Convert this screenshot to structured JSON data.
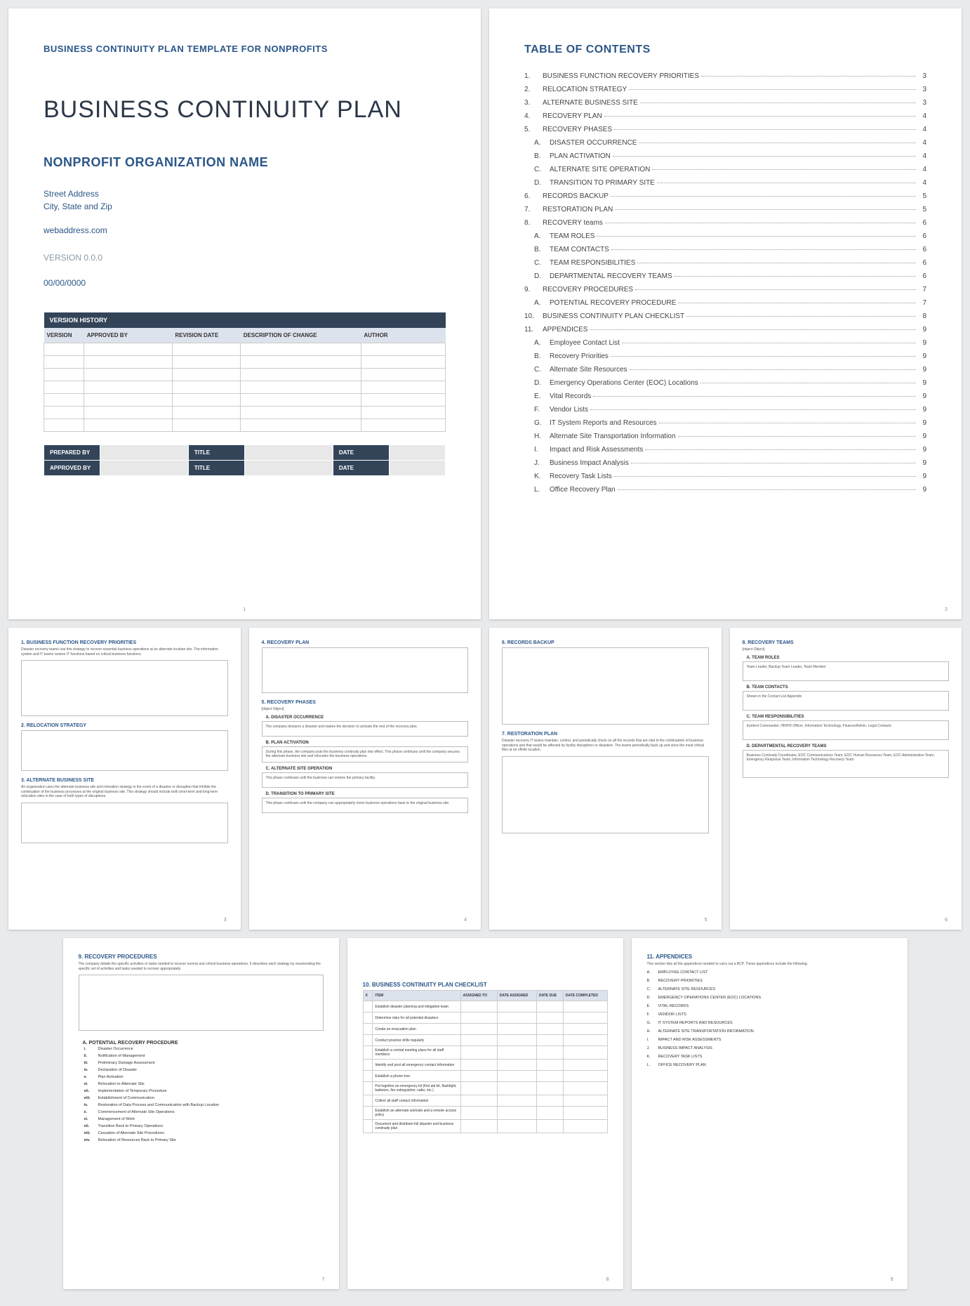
{
  "p1": {
    "header": "BUSINESS CONTINUITY PLAN TEMPLATE FOR NONPROFITS",
    "title": "BUSINESS CONTINUITY PLAN",
    "org": "NONPROFIT ORGANIZATION NAME",
    "addr1": "Street Address",
    "addr2": "City, State and Zip",
    "web": "webaddress.com",
    "ver": "VERSION 0.0.0",
    "date": "00/00/0000",
    "vh": {
      "title": "VERSION HISTORY",
      "cols": [
        "VERSION",
        "APPROVED BY",
        "REVISION DATE",
        "DESCRIPTION OF CHANGE",
        "AUTHOR"
      ]
    },
    "sig": {
      "r1": {
        "a": "PREPARED BY",
        "b": "TITLE",
        "c": "DATE"
      },
      "r2": {
        "a": "APPROVED BY",
        "b": "TITLE",
        "c": "DATE"
      }
    },
    "pn": "1"
  },
  "p2": {
    "title": "TABLE OF CONTENTS",
    "pn": "2",
    "items": [
      {
        "n": "1.",
        "t": "BUSINESS FUNCTION RECOVERY PRIORITIES",
        "p": "3"
      },
      {
        "n": "2.",
        "t": "RELOCATION STRATEGY",
        "p": "3"
      },
      {
        "n": "3.",
        "t": "ALTERNATE BUSINESS SITE",
        "p": "3"
      },
      {
        "n": "4.",
        "t": "RECOVERY PLAN",
        "p": "4"
      },
      {
        "n": "5.",
        "t": "RECOVERY PHASES",
        "p": "4"
      },
      {
        "n": "A.",
        "t": "DISASTER OCCURRENCE",
        "p": "4",
        "s": 1
      },
      {
        "n": "B.",
        "t": "PLAN ACTIVATION",
        "p": "4",
        "s": 1
      },
      {
        "n": "C.",
        "t": "ALTERNATE SITE OPERATION",
        "p": "4",
        "s": 1
      },
      {
        "n": "D.",
        "t": "TRANSITION TO PRIMARY SITE",
        "p": "4",
        "s": 1
      },
      {
        "n": "6.",
        "t": "RECORDS BACKUP",
        "p": "5"
      },
      {
        "n": "7.",
        "t": "RESTORATION PLAN",
        "p": "5"
      },
      {
        "n": "8.",
        "t": "RECOVERY teams",
        "p": "6"
      },
      {
        "n": "A.",
        "t": "TEAM ROLES",
        "p": "6",
        "s": 1
      },
      {
        "n": "B.",
        "t": "TEAM CONTACTS",
        "p": "6",
        "s": 1
      },
      {
        "n": "C.",
        "t": "TEAM RESPONSIBILITIES",
        "p": "6",
        "s": 1
      },
      {
        "n": "D.",
        "t": "DEPARTMENTAL RECOVERY TEAMS",
        "p": "6",
        "s": 1
      },
      {
        "n": "9.",
        "t": "RECOVERY PROCEDURES",
        "p": "7"
      },
      {
        "n": "A.",
        "t": "POTENTIAL RECOVERY PROCEDURE",
        "p": "7",
        "s": 1
      },
      {
        "n": "10.",
        "t": "BUSINESS CONTINUITY PLAN CHECKLIST",
        "p": "8"
      },
      {
        "n": "11.",
        "t": "APPENDICES",
        "p": "9"
      },
      {
        "n": "A.",
        "t": "Employee Contact List",
        "p": "9",
        "s": 1
      },
      {
        "n": "B.",
        "t": "Recovery Priorities",
        "p": "9",
        "s": 1
      },
      {
        "n": "C.",
        "t": "Alternate Site Resources",
        "p": "9",
        "s": 1
      },
      {
        "n": "D.",
        "t": "Emergency Operations Center (EOC) Locations",
        "p": "9",
        "s": 1
      },
      {
        "n": "E.",
        "t": "Vital Records",
        "p": "9",
        "s": 1
      },
      {
        "n": "F.",
        "t": "Vendor Lists",
        "p": "9",
        "s": 1
      },
      {
        "n": "G.",
        "t": "IT System Reports and Resources",
        "p": "9",
        "s": 1
      },
      {
        "n": "H.",
        "t": "Alternate Site Transportation Information",
        "p": "9",
        "s": 1
      },
      {
        "n": "I.",
        "t": "Impact and Risk Assessments",
        "p": "9",
        "s": 1
      },
      {
        "n": "J.",
        "t": "Business Impact Analysis",
        "p": "9",
        "s": 1
      },
      {
        "n": "K.",
        "t": "Recovery Task Lists",
        "p": "9",
        "s": 1
      },
      {
        "n": "L.",
        "t": "Office Recovery Plan",
        "p": "9",
        "s": 1
      }
    ]
  },
  "p3": {
    "pn": "3",
    "s1": {
      "h": "1. BUSINESS FUNCTION RECOVERY PRIORITIES",
      "d": "Disaster recovery teams use this strategy to recover essential business operations at an alternate location site. The information system and IT teams restore IT functions based on critical business functions."
    },
    "s2": {
      "h": "2. RELOCATION STRATEGY",
      "d": ""
    },
    "s3": {
      "h": "3. ALTERNATE BUSINESS SITE",
      "d": "An organization uses the alternate business site and relocation strategy in the event of a disaster or disruption that inhibits the continuation of the business processes at the original business site. This strategy should include both short-term and long-term relocation sites in the case of both types of disruptions."
    }
  },
  "p4": {
    "pn": "4",
    "s4": {
      "h": "4. RECOVERY PLAN"
    },
    "s5": {
      "h": "5. RECOVERY PHASES",
      "d": {
        "h": "D. TRANSITION TO PRIMARY SITE",
        "t": "This phase continues until the company can appropriately move business operations back to the original business site."
      },
      "a": {
        "h": "A. DISASTER OCCURRENCE",
        "t": "The company declares a disaster and makes the decision to activate the rest of the recovery plan."
      },
      "b": {
        "h": "B. PLAN ACTIVATION",
        "t": "During this phase, the company puts the business continuity plan into effect. This phase continues until the company secures the alternate business site and relocates the business operations."
      },
      "c": {
        "h": "C. ALTERNATE SITE OPERATION",
        "t": "This phase continues until the business can restore the primary facility."
      }
    }
  },
  "p5": {
    "pn": "5",
    "s6": {
      "h": "6. RECORDS BACKUP"
    },
    "s7": {
      "h": "7. RESTORATION PLAN",
      "d": "Disaster recovery IT teams maintain, control, and periodically check on all the records that are vital to the continuation of business operations and that would be affected by facility disruptions or disasters. The teams periodically back up and store the most critical files at an offsite location."
    }
  },
  "p6": {
    "pn": "6",
    "s8": {
      "h": "8. RECOVERY TEAMS",
      "d": {
        "h": "D. DEPARTMENTAL RECOVERY TEAMS",
        "t": "Business Continuity Coordinator, EOC Communications Team, EOC Human Resources Team, EOC Administration Team, Emergency Response Team, Information Technology Recovery Team"
      },
      "a": {
        "h": "A. TEAM ROLES",
        "t": "Team Leader, Backup Team Leader, Team Member"
      },
      "b": {
        "h": "B. TEAM CONTACTS",
        "t": "Shown in the Contact List Appendix"
      },
      "c": {
        "h": "C. TEAM RESPONSIBILITIES",
        "t": "Incident Commander, HR/PR Officer, Information Technology, Finance/Admin, Legal Contacts"
      }
    }
  },
  "p7": {
    "pn": "7",
    "s9": {
      "h": "9. RECOVERY PROCEDURES",
      "d": "The company details the specific activities or tasks needed to recover normal and critical business operations. It describes each strategy by enumerating the specific set of activities and tasks needed to recover appropriately."
    },
    "s9a": {
      "h": "A. POTENTIAL RECOVERY PROCEDURE",
      "items": [
        {
          "n": "i.",
          "t": "Disaster Occurrence"
        },
        {
          "n": "ii.",
          "t": "Notification of Management"
        },
        {
          "n": "iii.",
          "t": "Preliminary Damage Assessment"
        },
        {
          "n": "iv.",
          "t": "Declaration of Disaster"
        },
        {
          "n": "v.",
          "t": "Plan Activation"
        },
        {
          "n": "vi.",
          "t": "Relocation to Alternate Site"
        },
        {
          "n": "vii.",
          "t": "Implementation of Temporary Procedure"
        },
        {
          "n": "viii.",
          "t": "Establishment of Communication"
        },
        {
          "n": "ix.",
          "t": "Restoration of Data Process and Communication with Backup Location"
        },
        {
          "n": "x.",
          "t": "Commencement of Alternate Site Operations"
        },
        {
          "n": "xi.",
          "t": "Management of Work"
        },
        {
          "n": "xii.",
          "t": "Transition Back to Primary Operations"
        },
        {
          "n": "xiii.",
          "t": "Cessation of Alternate Site Procedures"
        },
        {
          "n": "xiv.",
          "t": "Relocation of Resources Back to Primary Site"
        }
      ]
    }
  },
  "p8": {
    "pn": "8",
    "s10": {
      "h": "10.   BUSINESS CONTINUITY PLAN CHECKLIST",
      "cols": [
        "X",
        "ITEM",
        "ASSIGNED TO",
        "DATE ASSIGNED",
        "DATE DUE",
        "DATE COMPLETED"
      ],
      "rows": [
        "Establish disaster planning and mitigation team",
        "Determine risks for all potential disasters",
        "Create an evacuation plan",
        "Conduct practice drills regularly",
        "Establish a central meeting place for all staff members",
        "Identify and post all emergency contact information",
        "Establish a phone tree",
        "Put together an emergency kit (first aid kit, flashlight, batteries, fire extinguisher, radio, etc.)",
        "Collect all staff contact information",
        "Establish an alternate worksite and a remote access policy",
        "Document and distribute full disaster and business continuity plan"
      ]
    }
  },
  "p9": {
    "pn": "9",
    "s11": {
      "h": "11.   APPENDICES",
      "d": "This section lists all the appendices needed to carry out a BCP. These appendices include the following:",
      "items": [
        {
          "n": "A.",
          "t": "EMPLOYEE CONTACT LIST"
        },
        {
          "n": "B.",
          "t": "RECOVERY PRIORITIES"
        },
        {
          "n": "C.",
          "t": "ALTERNATE SITE RESOURCES"
        },
        {
          "n": "D.",
          "t": "EMERGENCY OPERATIONS CENTER (EOC) LOCATIONS"
        },
        {
          "n": "E.",
          "t": "VITAL RECORDS"
        },
        {
          "n": "F.",
          "t": "VENDOR LISTS"
        },
        {
          "n": "G.",
          "t": "IT SYSTEM REPORTS AND RESOURCES"
        },
        {
          "n": "H.",
          "t": "ALTERNATE SITE TRANSPORTATION INFORMATION"
        },
        {
          "n": "I.",
          "t": "IMPACT AND RISK ASSESSMENTS"
        },
        {
          "n": "J.",
          "t": "BUSINESS IMPACT ANALYSIS"
        },
        {
          "n": "K.",
          "t": "RECOVERY TASK LISTS"
        },
        {
          "n": "L.",
          "t": "OFFICE RECOVERY PLAN"
        }
      ]
    }
  }
}
